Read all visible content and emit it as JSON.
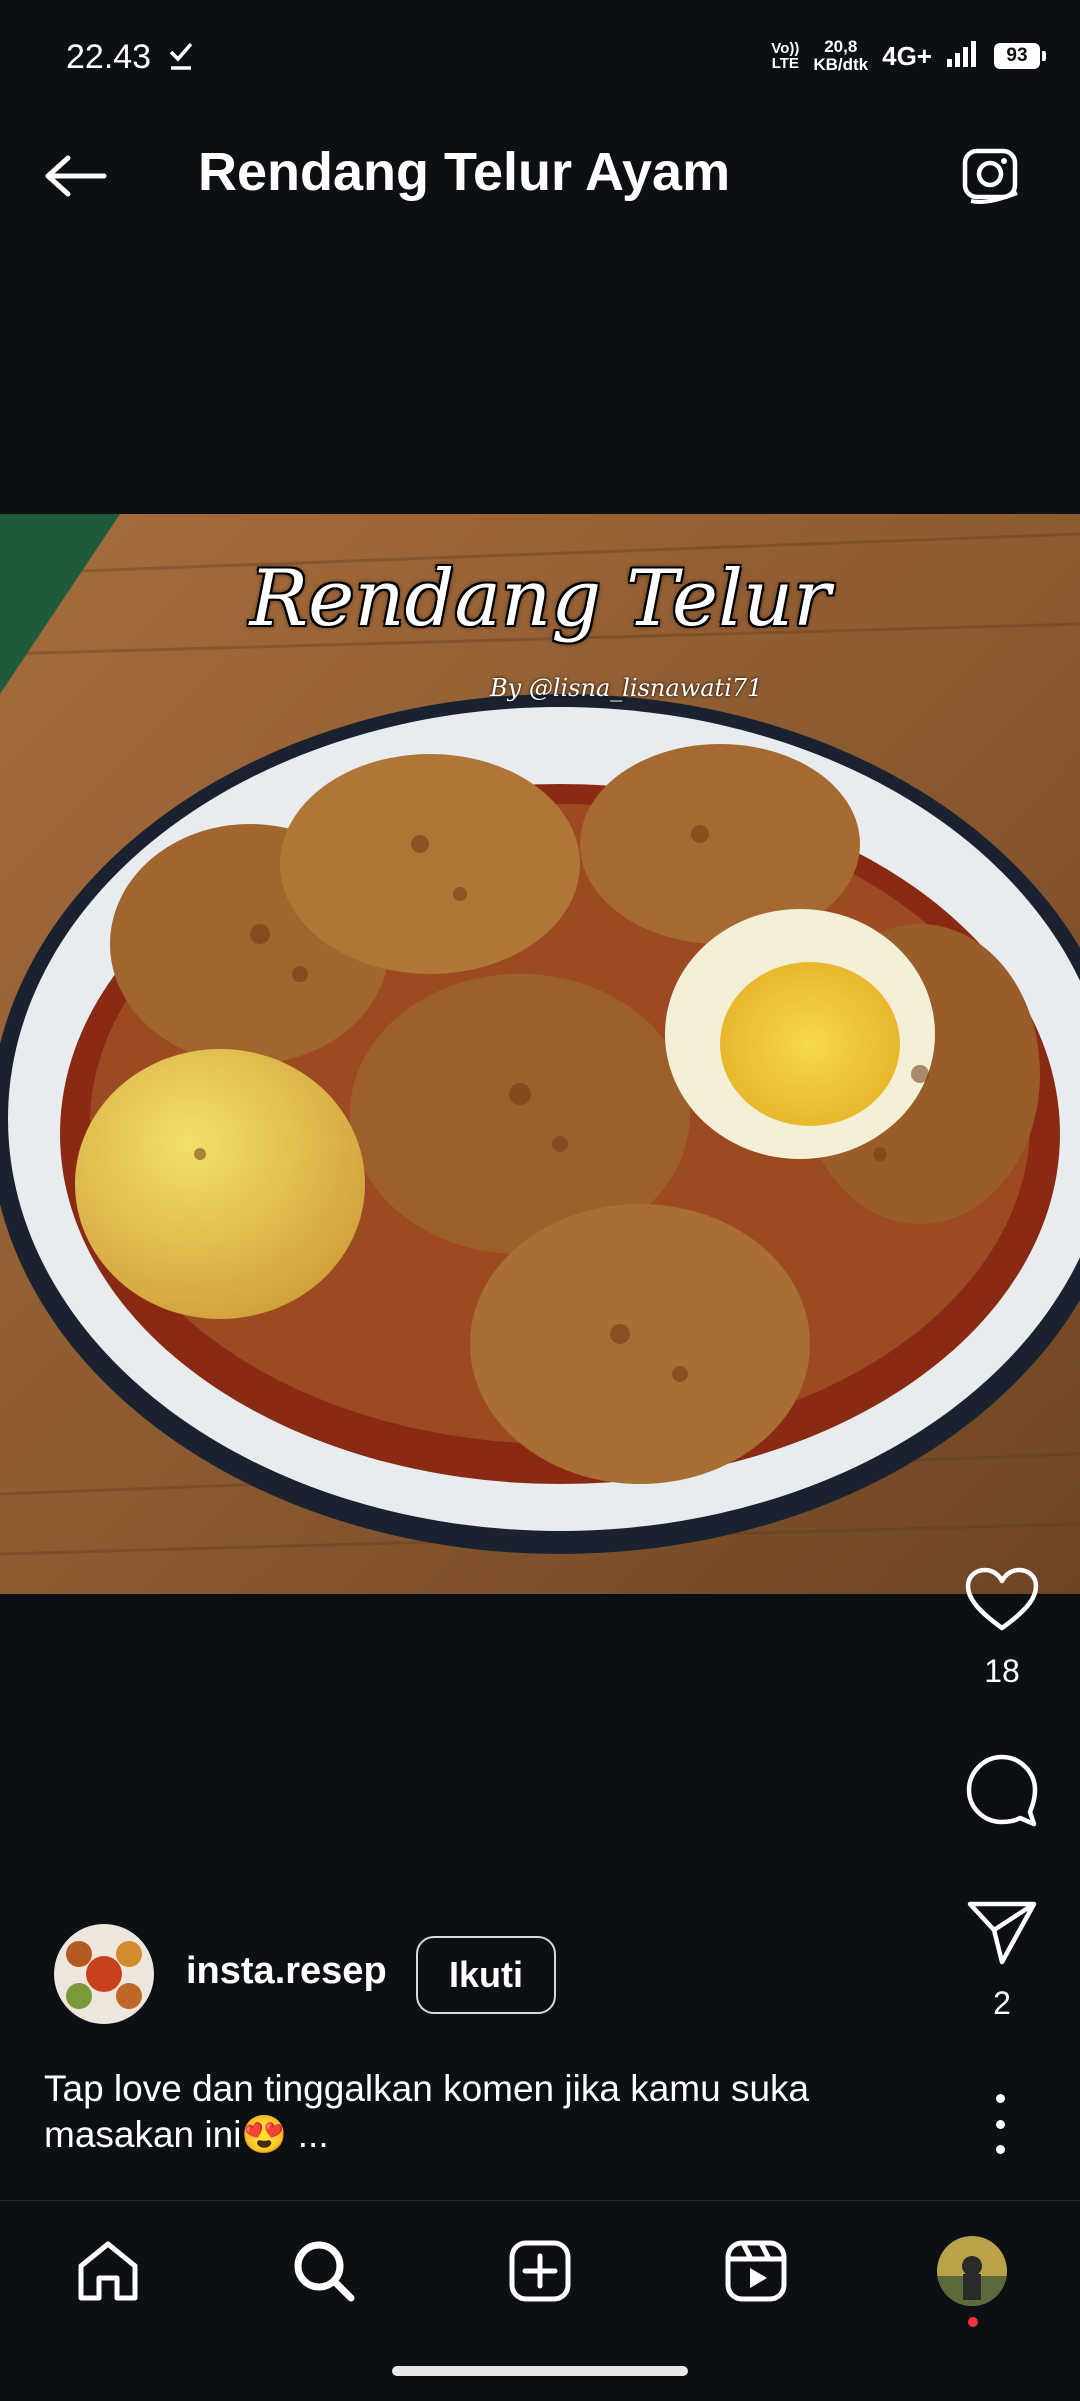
{
  "status_bar": {
    "time": "22.43",
    "volte_top": "Vo))",
    "volte_bottom": "LTE",
    "speed_value": "20,8",
    "speed_unit": "KB/dtk",
    "network": "4G+",
    "battery": "93"
  },
  "header": {
    "title": "Rendang Telur Ayam"
  },
  "photo": {
    "overlay_title": "Rendang Telur",
    "overlay_credit": "By @lisna_lisnawati71"
  },
  "actions": {
    "likes": "18",
    "shares": "2"
  },
  "author": {
    "username": "insta.resep",
    "follow_label": "Ikuti"
  },
  "caption": {
    "text": "Tap love dan tinggalkan komen jika kamu suka masakan ini😍 ..."
  },
  "bottom_nav": {
    "items": [
      "home",
      "search",
      "create",
      "reels",
      "profile"
    ]
  },
  "colors": {
    "background": "#0c0f14",
    "notification_dot": "#ff3040"
  }
}
